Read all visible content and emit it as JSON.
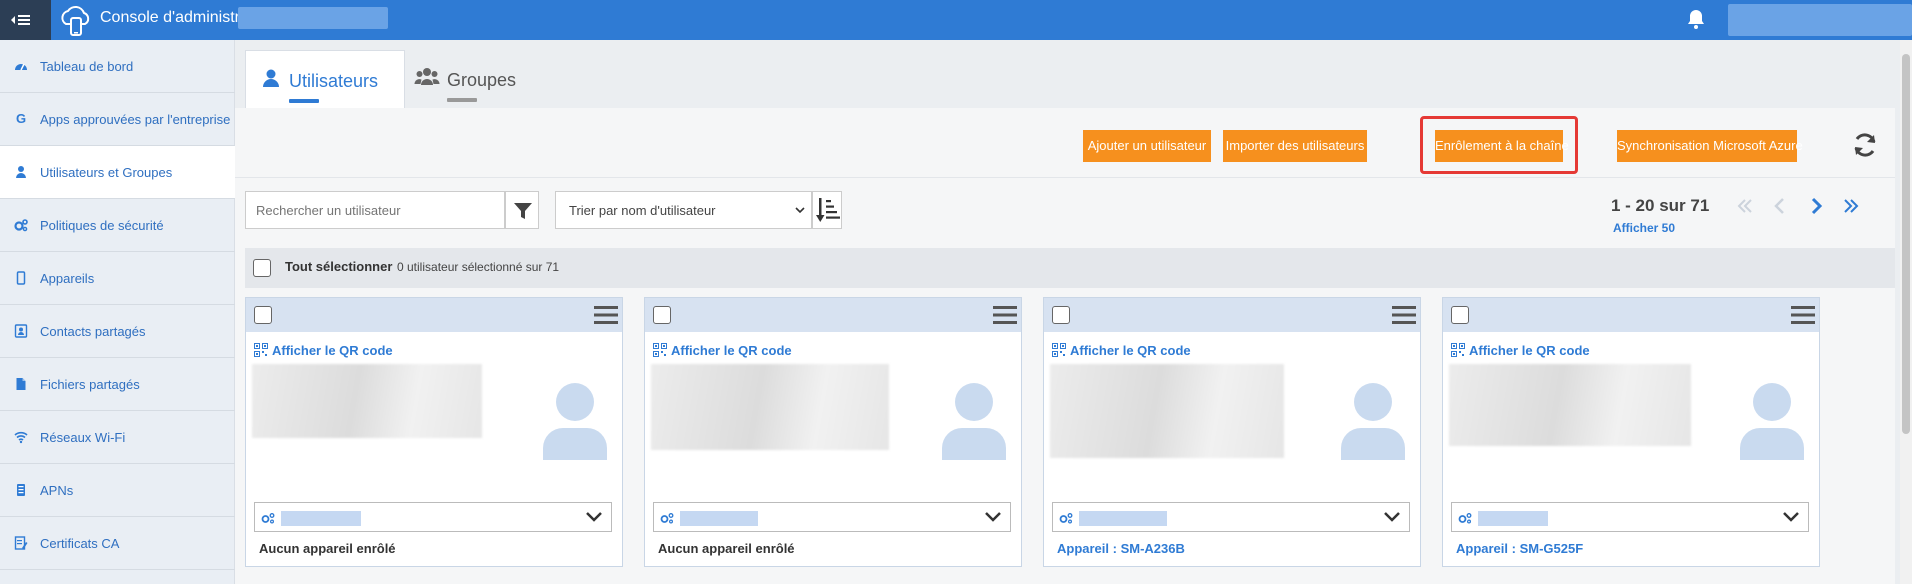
{
  "header": {
    "title": "Console d'administration"
  },
  "sidebar": {
    "items": [
      {
        "label": "Tableau de bord",
        "icon": "dashboard-icon"
      },
      {
        "label": "Apps approuvées par l'entreprise",
        "icon": "google-icon"
      },
      {
        "label": "Utilisateurs et Groupes",
        "icon": "user-icon"
      },
      {
        "label": "Politiques de sécurité",
        "icon": "gears-icon"
      },
      {
        "label": "Appareils",
        "icon": "mobile-icon"
      },
      {
        "label": "Contacts partagés",
        "icon": "contact-card-icon"
      },
      {
        "label": "Fichiers partagés",
        "icon": "file-icon"
      },
      {
        "label": "Réseaux Wi-Fi",
        "icon": "wifi-icon"
      },
      {
        "label": "APNs",
        "icon": "apn-icon"
      },
      {
        "label": "Certificats CA",
        "icon": "certificate-icon"
      }
    ]
  },
  "tabs": [
    {
      "label": "Utilisateurs",
      "active": true
    },
    {
      "label": "Groupes",
      "active": false
    }
  ],
  "toolbar": {
    "add_user": "Ajouter un utilisateur",
    "import_users": "Importer des utilisateurs",
    "chain_enroll": "Enrôlement à la chaîne",
    "azure_sync": "Synchronisation Microsoft Azure"
  },
  "search": {
    "placeholder": "Rechercher un utilisateur",
    "sort_label": "Trier par nom d'utilisateur"
  },
  "pagination": {
    "range": "1 - 20 sur 71",
    "show_more": "Afficher 50"
  },
  "selection": {
    "select_all": "Tout sélectionner",
    "count": "0 utilisateur sélectionné sur 71"
  },
  "cards": [
    {
      "qr_label": "Afficher le QR code",
      "device": "Aucun appareil enrôlé"
    },
    {
      "qr_label": "Afficher le QR code",
      "device": "Aucun appareil enrôlé"
    },
    {
      "qr_label": "Afficher le QR code",
      "device": "Appareil : SM-A236B"
    },
    {
      "qr_label": "Afficher le QR code",
      "device": "Appareil : SM-G525F"
    }
  ],
  "colors": {
    "topbar": "#2f7bd4",
    "accent_orange": "#f6901e",
    "highlight_red": "#e53935",
    "link_blue": "#2f7bd4"
  }
}
